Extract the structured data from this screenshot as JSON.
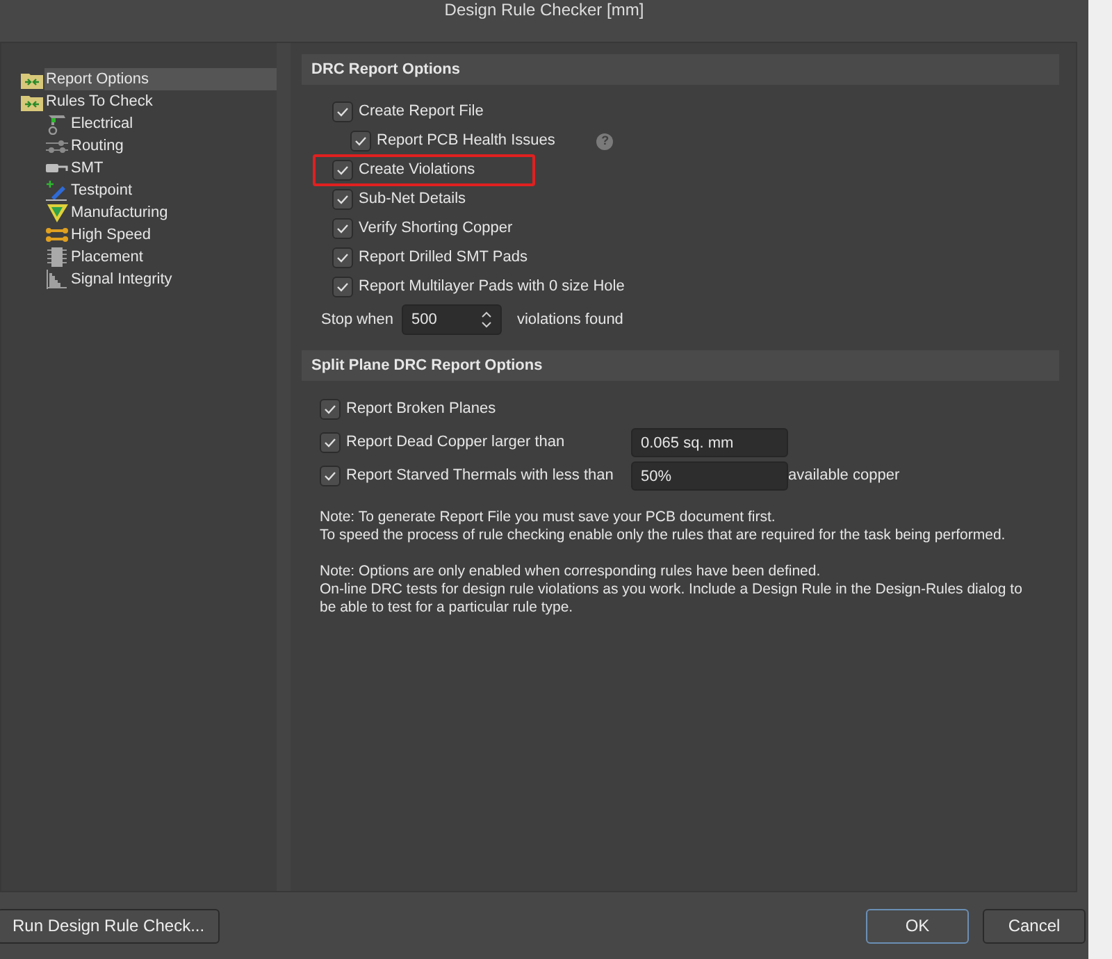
{
  "window": {
    "title": "Design Rule Checker [mm]"
  },
  "sidebar": {
    "items": [
      {
        "label": "Report Options",
        "selected": true,
        "kind": "folder"
      },
      {
        "label": "Rules To Check",
        "selected": false,
        "kind": "folder",
        "children": [
          {
            "label": "Electrical",
            "selected": false,
            "kind": "electrical"
          },
          {
            "label": "Routing",
            "selected": false,
            "kind": "routing"
          },
          {
            "label": "SMT",
            "selected": false,
            "kind": "smt"
          },
          {
            "label": "Testpoint",
            "selected": false,
            "kind": "testpoint"
          },
          {
            "label": "Manufacturing",
            "selected": false,
            "kind": "manufacturing"
          },
          {
            "label": "High Speed",
            "selected": false,
            "kind": "highspeed"
          },
          {
            "label": "Placement",
            "selected": false,
            "kind": "placement"
          },
          {
            "label": "Signal Integrity",
            "selected": false,
            "kind": "signal"
          }
        ]
      }
    ]
  },
  "drc_section": {
    "title": "DRC Report Options",
    "options": [
      {
        "label": "Create Report File",
        "checked": true,
        "indented": false,
        "highlighted": false
      },
      {
        "label": "Report PCB Health Issues",
        "checked": true,
        "indented": true,
        "highlighted": false,
        "help": "?"
      },
      {
        "label": "Create Violations",
        "checked": true,
        "indented": false,
        "highlighted": true
      },
      {
        "label": "Sub-Net Details",
        "checked": true,
        "indented": false,
        "highlighted": false
      },
      {
        "label": "Verify Shorting Copper",
        "checked": true,
        "indented": false,
        "highlighted": false
      },
      {
        "label": "Report Drilled SMT Pads",
        "checked": true,
        "indented": false,
        "highlighted": false
      },
      {
        "label": "Report Multilayer Pads with 0 size Hole",
        "checked": true,
        "indented": false,
        "highlighted": false
      }
    ],
    "stop_when": {
      "label": "Stop when",
      "value": "500",
      "suffix": "violations found"
    }
  },
  "split_section": {
    "title": "Split Plane DRC Report Options",
    "options": [
      {
        "label": "Report Broken Planes",
        "checked": true
      },
      {
        "label": "Report Dead Copper larger than",
        "checked": true,
        "value": "0.065 sq. mm"
      },
      {
        "label": "Report Starved Thermals with less than",
        "checked": true,
        "value": "50%",
        "suffix": "available copper"
      }
    ]
  },
  "notes": [
    [
      "Note: To generate Report File you must save your PCB document first.",
      "To speed the process of rule checking enable only the rules that are required for the task being performed."
    ],
    [
      "Note: Options are only enabled when corresponding rules have been defined.",
      "On-line DRC tests for design rule violations as you work. Include a Design Rule in the Design-Rules dialog to be able to test for a particular rule  type."
    ]
  ],
  "buttons": {
    "run": "Run Design Rule Check...",
    "ok": "OK",
    "cancel": "Cancel"
  }
}
